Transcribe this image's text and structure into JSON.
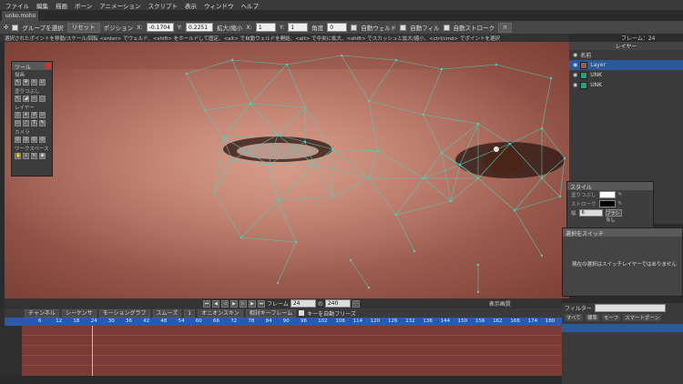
{
  "menu": [
    "ファイル",
    "編集",
    "描画",
    "ボーン",
    "アニメーション",
    "スクリプト",
    "表示",
    "ウィンドウ",
    "ヘルプ"
  ],
  "document_tab": "unko.moho",
  "toolbar": {
    "group_select": "グループを選択",
    "reset": "リセット",
    "position_label": "ポジション",
    "x_label": "X:",
    "pos_x": "-0.1704",
    "y_label": "Y:",
    "pos_y": "0.2251",
    "scale_label": "拡大/縮小",
    "scale_x_label": "X:",
    "scale_x": "1",
    "scale_y_label": "Y:",
    "scale_y": "1",
    "angle_label": "角度",
    "angle": "0",
    "auto_weld": "自動ウェルド",
    "auto_fill": "自動フィル",
    "auto_stroke": "自動ストローク"
  },
  "status_text": "選択されたポイントを移動/スケール/回転  <enter> でウェルド、<shift> をホールドして固定、<alt> で自動ウェルドを開始、<alt> で中央に拡大、<shift> でスカッシュと拡大/縮小、<ctrl/cmd> でポイントを選択",
  "frame_label": "フレーム：24",
  "tool_panel": {
    "title": "ツール",
    "sections": [
      "描画",
      "塗りつぶし",
      "レイヤー",
      "カメラ",
      "ワークスペース"
    ]
  },
  "layers_panel": {
    "title": "レイヤー",
    "name_header": "名前",
    "rows": [
      {
        "name": "Layer",
        "selected": true
      },
      {
        "name": "UNK",
        "selected": false
      },
      {
        "name": "UNK",
        "selected": false
      }
    ]
  },
  "style_panel": {
    "title": "スタイル",
    "fill_label": "塗りつぶし",
    "stroke_label": "ストローク",
    "width_label": "幅",
    "width_value": "6",
    "brush_button": "ブラシなし",
    "fill_color": "#ffffff",
    "stroke_color": "#000000"
  },
  "switch_panel": {
    "title": "選択をスイッチ",
    "message": "現在の選択はスイッチレイヤーではありません"
  },
  "playback": {
    "frame_label": "フレーム",
    "frame_value": "24",
    "of_label": "の",
    "end_value": "240",
    "display_quality": "表示画質"
  },
  "timeline": {
    "tabs": [
      "チャンネル",
      "シーケンサ",
      "モーショングラフ"
    ],
    "smooth": "スムーズ",
    "interp_value": "1",
    "onion": "オニオンスキン",
    "relative_keyframe": "相対キーフレーム",
    "auto_freeze": "キーを自動フリーズ",
    "ruler": [
      "6",
      "12",
      "18",
      "24",
      "30",
      "36",
      "42",
      "48",
      "54",
      "60",
      "66",
      "72",
      "78",
      "84",
      "90",
      "96",
      "102",
      "108",
      "114",
      "120",
      "126",
      "132",
      "138",
      "144",
      "150",
      "156",
      "162",
      "168",
      "174",
      "180"
    ]
  },
  "filter_panel": {
    "label": "フィルター",
    "tabs": [
      "すべて",
      "標準",
      "モーフ",
      "スマートボーン"
    ]
  },
  "colors": {
    "accent": "#2b5a9a",
    "mesh": "#4fd0b8",
    "track": "#7a3a36"
  }
}
